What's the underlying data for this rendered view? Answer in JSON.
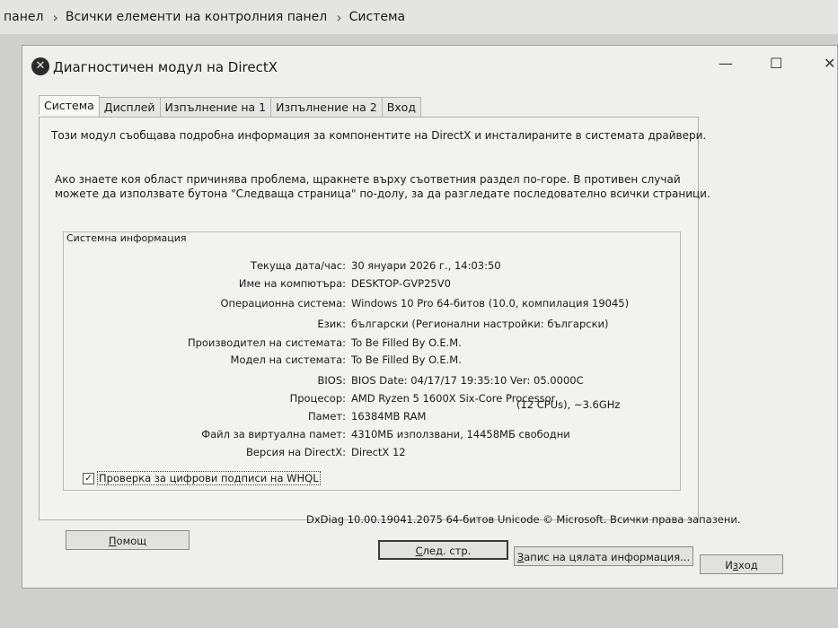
{
  "breadcrumb": {
    "items": [
      "панел",
      "Всички елементи на контролния панел",
      "Система"
    ],
    "separator": "›"
  },
  "window": {
    "title": "Диагностичен модул на DirectX",
    "icon": "directx-icon",
    "minimize": "—",
    "maximize": "☐",
    "close": "✕"
  },
  "tabs": [
    {
      "label": "Система",
      "active": true
    },
    {
      "label": "Дисплей",
      "active": false
    },
    {
      "label": "Изпълнение на 1",
      "active": false
    },
    {
      "label": "Изпълнение на 2",
      "active": false
    },
    {
      "label": "Вход",
      "active": false
    }
  ],
  "intro": {
    "line1": "Този модул съобщава подробна информация за компонентите на DirectX и инсталираните в системата драйвери.",
    "line2": "Ако знаете коя област причинява проблема, щракнете върху съответния раздел по-горе. В противен случай можете да използвате бутона \"Следваща страница\" по-долу, за да разгледате последователно всички страници."
  },
  "system_info": {
    "group_title": "Системна информация",
    "rows": [
      {
        "label": "Текуща дата/час:",
        "value": "30 януари 2026 г., 14:03:50"
      },
      {
        "label": "Име на компютъра:",
        "value": "DESKTOP-GVP25V0"
      },
      {
        "label": "Операционна система:",
        "value": "Windows 10 Pro 64-битов (10.0, компилация 19045)"
      },
      {
        "label": "Език:",
        "value": "български (Регионални настройки: български)"
      },
      {
        "label": "Производител на системата:",
        "value": "To Be Filled By O.E.M."
      },
      {
        "label": "Модел на системата:",
        "value": "To Be Filled By O.E.M."
      },
      {
        "label": "BIOS:",
        "value": "BIOS Date: 04/17/17 19:35:10 Ver: 05.0000C"
      },
      {
        "label": "Процесор:",
        "value": "AMD Ryzen 5 1600X Six-Core Processor"
      },
      {
        "label": "Памет:",
        "value": "16384MB RAM"
      },
      {
        "label": "Файл за виртуална памет:",
        "value": "4310МБ използвани, 14458МБ свободни"
      },
      {
        "label": "Версия на DirectX:",
        "value": "DirectX 12"
      }
    ],
    "cpu_extra": "(12 CPUs), ~3.6GHz"
  },
  "whql": {
    "label": "Проверка за цифрови подписи на WHQL",
    "checked": true,
    "check_glyph": "✓"
  },
  "copyright": "DxDiag 10.00.19041.2075 64-битов Unicode © Microsoft. Всички права запазени.",
  "buttons": {
    "help": {
      "pre": "",
      "key": "П",
      "post": "омощ"
    },
    "next": {
      "pre": "",
      "key": "С",
      "post": "лед. стр."
    },
    "save": {
      "pre": "",
      "key": "З",
      "post": "апис на цялата информация..."
    },
    "exit": {
      "pre": "И",
      "key": "з",
      "post": "ход"
    }
  }
}
